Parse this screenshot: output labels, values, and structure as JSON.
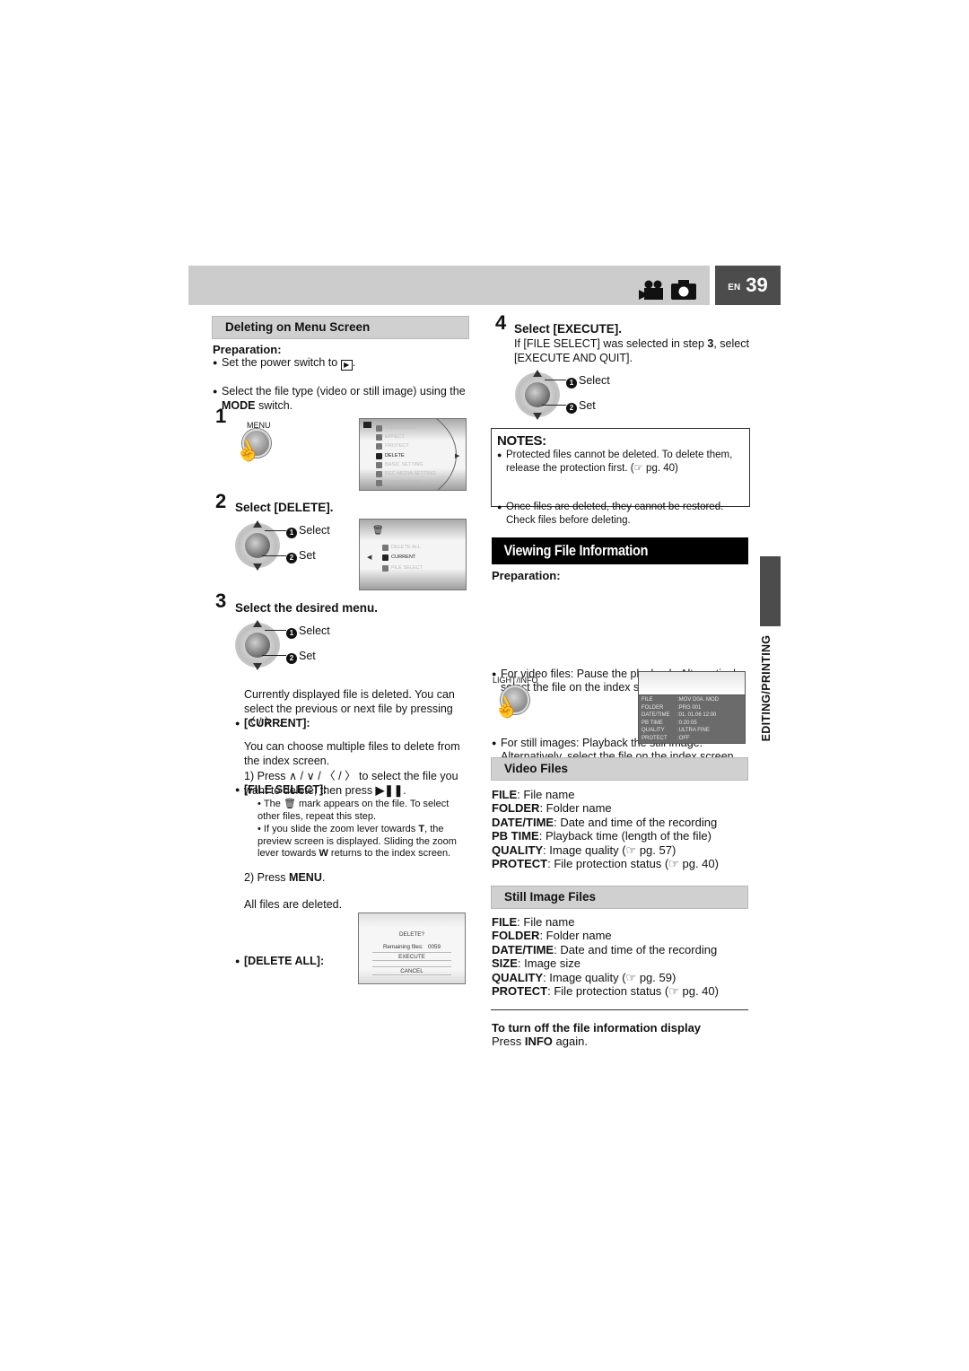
{
  "header": {
    "lang": "EN",
    "page_number": "39",
    "mode_icons": [
      "video-camera-icon",
      "still-camera-icon"
    ]
  },
  "side_tab": {
    "label": "EDITING/PRINTING"
  },
  "left": {
    "section_title": "Deleting on Menu Screen",
    "preparation_label": "Preparation:",
    "prep_items": [
      {
        "pre": "Set the power switch to ",
        "icon": "play-icon",
        "post": "."
      },
      {
        "pre": "Select the file type (video or still image) using the ",
        "bold": "MODE",
        "post": " switch."
      }
    ],
    "step1": {
      "num": "1",
      "button_label": "MENU",
      "lcd_menu": {
        "items": [
          "WIPE/FADER",
          "EFFECT",
          "PROTECT",
          "DELETE",
          "BASIC SETTING",
          "REC MEDIA SETTING",
          "DATE/DISPLAY"
        ],
        "selected": "DELETE"
      }
    },
    "step2": {
      "num": "2",
      "title": "Select [DELETE].",
      "select_label": "Select",
      "set_label": "Set",
      "lcd_menu": {
        "items": [
          "DELETE ALL",
          "CURRENT",
          "FILE SELECT"
        ],
        "selected": "CURRENT"
      }
    },
    "step3": {
      "num": "3",
      "title": "Select the desired menu.",
      "select_label": "Select",
      "set_label": "Set",
      "options": [
        {
          "label": "[CURRENT]:",
          "text": "Currently displayed file is deleted. You can select the previous or next file by pressing",
          "suffix": "〈 / 〉 ."
        },
        {
          "label": "[FILE SELECT]:",
          "text": "You can choose multiple files to delete from the index screen.",
          "substeps": [
            {
              "num": "1)",
              "pre": "Press ∧ / ∨ / 〈 / 〉 to select the file you want to delete, then press ",
              "bold": "▶❚❚",
              "post": "."
            },
            {
              "num": "2)",
              "pre": "Press ",
              "bold": "MENU",
              "post": "."
            }
          ],
          "subnotes": [
            {
              "pre": "The ",
              "icon": "trash-mark-icon",
              "post": " mark appears on the file. To select other files, repeat this step."
            },
            {
              "pre": "If you slide the zoom lever towards ",
              "b1": "T",
              "mid": ", the preview screen is displayed. Sliding the zoom lever towards ",
              "b2": "W",
              "post": " returns to the index screen."
            }
          ]
        },
        {
          "label": "[DELETE ALL]:",
          "text": "All files are deleted."
        }
      ],
      "dialog": {
        "title": "DELETE?",
        "remaining_label": "Remaining files:",
        "remaining_value": "0059",
        "execute": "EXECUTE",
        "cancel": "CANCEL"
      }
    }
  },
  "right": {
    "step4": {
      "num": "4",
      "title": "Select [EXECUTE].",
      "text_pre": "If [FILE SELECT] was selected in step ",
      "text_bold": "3",
      "text_post": ", select [EXECUTE AND QUIT].",
      "select_label": "Select",
      "set_label": "Set"
    },
    "notes": {
      "title": "NOTES:",
      "items": [
        "Protected files cannot be deleted. To delete them, release the protection first. (☞ pg. 40)",
        "Once files are deleted, they cannot be restored. Check files before deleting."
      ]
    },
    "viewing": {
      "title": "Viewing File Information",
      "preparation_label": "Preparation:",
      "prep_items": [
        "For video files: Pause the playback. Alternatively, select the file on the index screen.",
        "For still images: Playback the still image. Alternatively, select the file on the index screen."
      ],
      "button_label": "LIGHT/INFO",
      "info_lcd": [
        {
          "k": "FILE",
          "v": ":MOV D0A. MOD"
        },
        {
          "k": "FOLDER",
          "v": ":PRG 001"
        },
        {
          "k": "DATE/TIME",
          "v": ":01. 01.06 12:00"
        },
        {
          "k": "PB TIME",
          "v": ":0:20:05"
        },
        {
          "k": "QUALITY",
          "v": ":ULTRA FINE"
        },
        {
          "k": "PROTECT",
          "v": ":OFF"
        }
      ]
    },
    "video_files": {
      "title": "Video Files",
      "items": [
        {
          "k": "FILE",
          "v": ": File name"
        },
        {
          "k": "FOLDER",
          "v": ": Folder name"
        },
        {
          "k": "DATE/TIME",
          "v": ": Date and time of the recording"
        },
        {
          "k": "PB TIME",
          "v": ": Playback time (length of the file)"
        },
        {
          "k": "QUALITY",
          "v": ": Image quality (☞ pg. 57)"
        },
        {
          "k": "PROTECT",
          "v": ": File protection status (☞ pg. 40)"
        }
      ]
    },
    "still_files": {
      "title": "Still Image Files",
      "items": [
        {
          "k": "FILE",
          "v": ": File name"
        },
        {
          "k": "FOLDER",
          "v": ": Folder name"
        },
        {
          "k": "DATE/TIME",
          "v": ": Date and time of the recording"
        },
        {
          "k": "SIZE",
          "v": ": Image size"
        },
        {
          "k": "QUALITY",
          "v": ": Image quality (☞ pg. 59)"
        },
        {
          "k": "PROTECT",
          "v": ": File protection status (☞ pg. 40)"
        }
      ]
    },
    "turn_off": {
      "title": "To turn off the file information display",
      "pre": "Press ",
      "bold": "INFO",
      "post": " again."
    }
  }
}
